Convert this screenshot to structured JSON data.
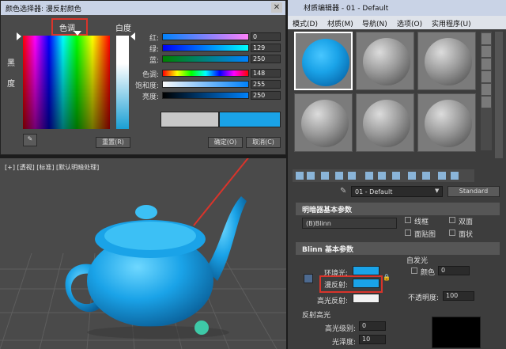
{
  "picker": {
    "title": "颜色选择器: 漫反射颜色",
    "hue_label": "色调",
    "whiteness_label": "白度",
    "blackness_label": "黑",
    "blackness_label2": "度",
    "channels": [
      {
        "label": "红:",
        "value": "0"
      },
      {
        "label": "绿:",
        "value": "129"
      },
      {
        "label": "蓝:",
        "value": "250"
      },
      {
        "label": "色调:",
        "value": "148"
      },
      {
        "label": "饱和度:",
        "value": "255"
      },
      {
        "label": "亮度:",
        "value": "250"
      }
    ],
    "reset_label": "重置(R)",
    "ok_label": "确定(O)",
    "cancel_label": "取消(C)",
    "close_glyph": "✕"
  },
  "viewport": {
    "label": "[+] [透视] [标准] [默认明暗处理]"
  },
  "material": {
    "title": "材质编辑器 - 01 - Default",
    "menu": [
      "模式(D)",
      "材质(M)",
      "导航(N)",
      "选项(O)",
      "实用程序(U)"
    ],
    "material_name": "01 - Default",
    "shader_type": "Standard",
    "shader_rollout": "明暗器基本参数",
    "shader": "(B)Blinn",
    "shader_options": [
      "线框",
      "双面",
      "面贴图",
      "面状"
    ],
    "blinn_rollout": "Blinn 基本参数",
    "self_illum_label": "自发光",
    "color_label": "颜色",
    "color_value": "0",
    "ambient_label": "环境光:",
    "diffuse_label": "漫反射:",
    "specular_label": "高光反射:",
    "opacity_label": "不透明度:",
    "opacity_value": "100",
    "highlights_label": "反射高光",
    "spec_level_label": "高光级别:",
    "spec_level_value": "0",
    "gloss_label": "光泽度:",
    "gloss_value": "10"
  },
  "colors": {
    "diffuse": "#1aa3e8",
    "accent_red": "#d9342b"
  }
}
